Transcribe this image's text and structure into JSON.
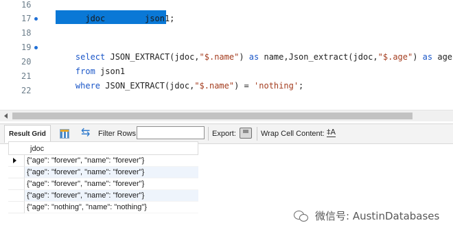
{
  "editor": {
    "lines": [
      {
        "num": "16"
      },
      {
        "num": "17",
        "selected": "      jdoc        json1;"
      },
      {
        "num": "18"
      },
      {
        "num": "19",
        "tokens": [
          {
            "t": "select ",
            "c": "kw"
          },
          {
            "t": "JSON_EXTRACT(jdoc,",
            "c": ""
          },
          {
            "t": "\"$.name\"",
            "c": "str"
          },
          {
            "t": ") ",
            "c": ""
          },
          {
            "t": "as ",
            "c": "kw"
          },
          {
            "t": "name,Json_extract(jdoc,",
            "c": ""
          },
          {
            "t": "\"$.age\"",
            "c": "str"
          },
          {
            "t": ") ",
            "c": ""
          },
          {
            "t": "as ",
            "c": "kw"
          },
          {
            "t": "age",
            "c": ""
          }
        ]
      },
      {
        "num": "20",
        "tokens": [
          {
            "t": "from ",
            "c": "kw"
          },
          {
            "t": "json1",
            "c": ""
          }
        ]
      },
      {
        "num": "21",
        "tokens": [
          {
            "t": "where ",
            "c": "kw"
          },
          {
            "t": "JSON_EXTRACT(jdoc,",
            "c": ""
          },
          {
            "t": "\"$.name\"",
            "c": "str"
          },
          {
            "t": ") = ",
            "c": ""
          },
          {
            "t": "'nothing'",
            "c": "str"
          },
          {
            "t": ";",
            "c": ""
          }
        ]
      },
      {
        "num": "22"
      }
    ]
  },
  "toolbar": {
    "result_grid_tab": "Result Grid",
    "filter_label": "Filter Rows:",
    "filter_value": "",
    "export_label": "Export:",
    "wrap_label": "Wrap Cell Content:",
    "wrap_icon_glyph": "‡A"
  },
  "grid": {
    "column": "jdoc",
    "rows": [
      "{\"age\": \"forever\", \"name\": \"forever\"}",
      "{\"age\": \"forever\", \"name\": \"forever\"}",
      "{\"age\": \"forever\", \"name\": \"forever\"}",
      "{\"age\": \"forever\", \"name\": \"forever\"}",
      "{\"age\": \"nothing\", \"name\": \"nothing\"}"
    ]
  },
  "watermark": {
    "text": "微信号: AustinDatabases"
  }
}
